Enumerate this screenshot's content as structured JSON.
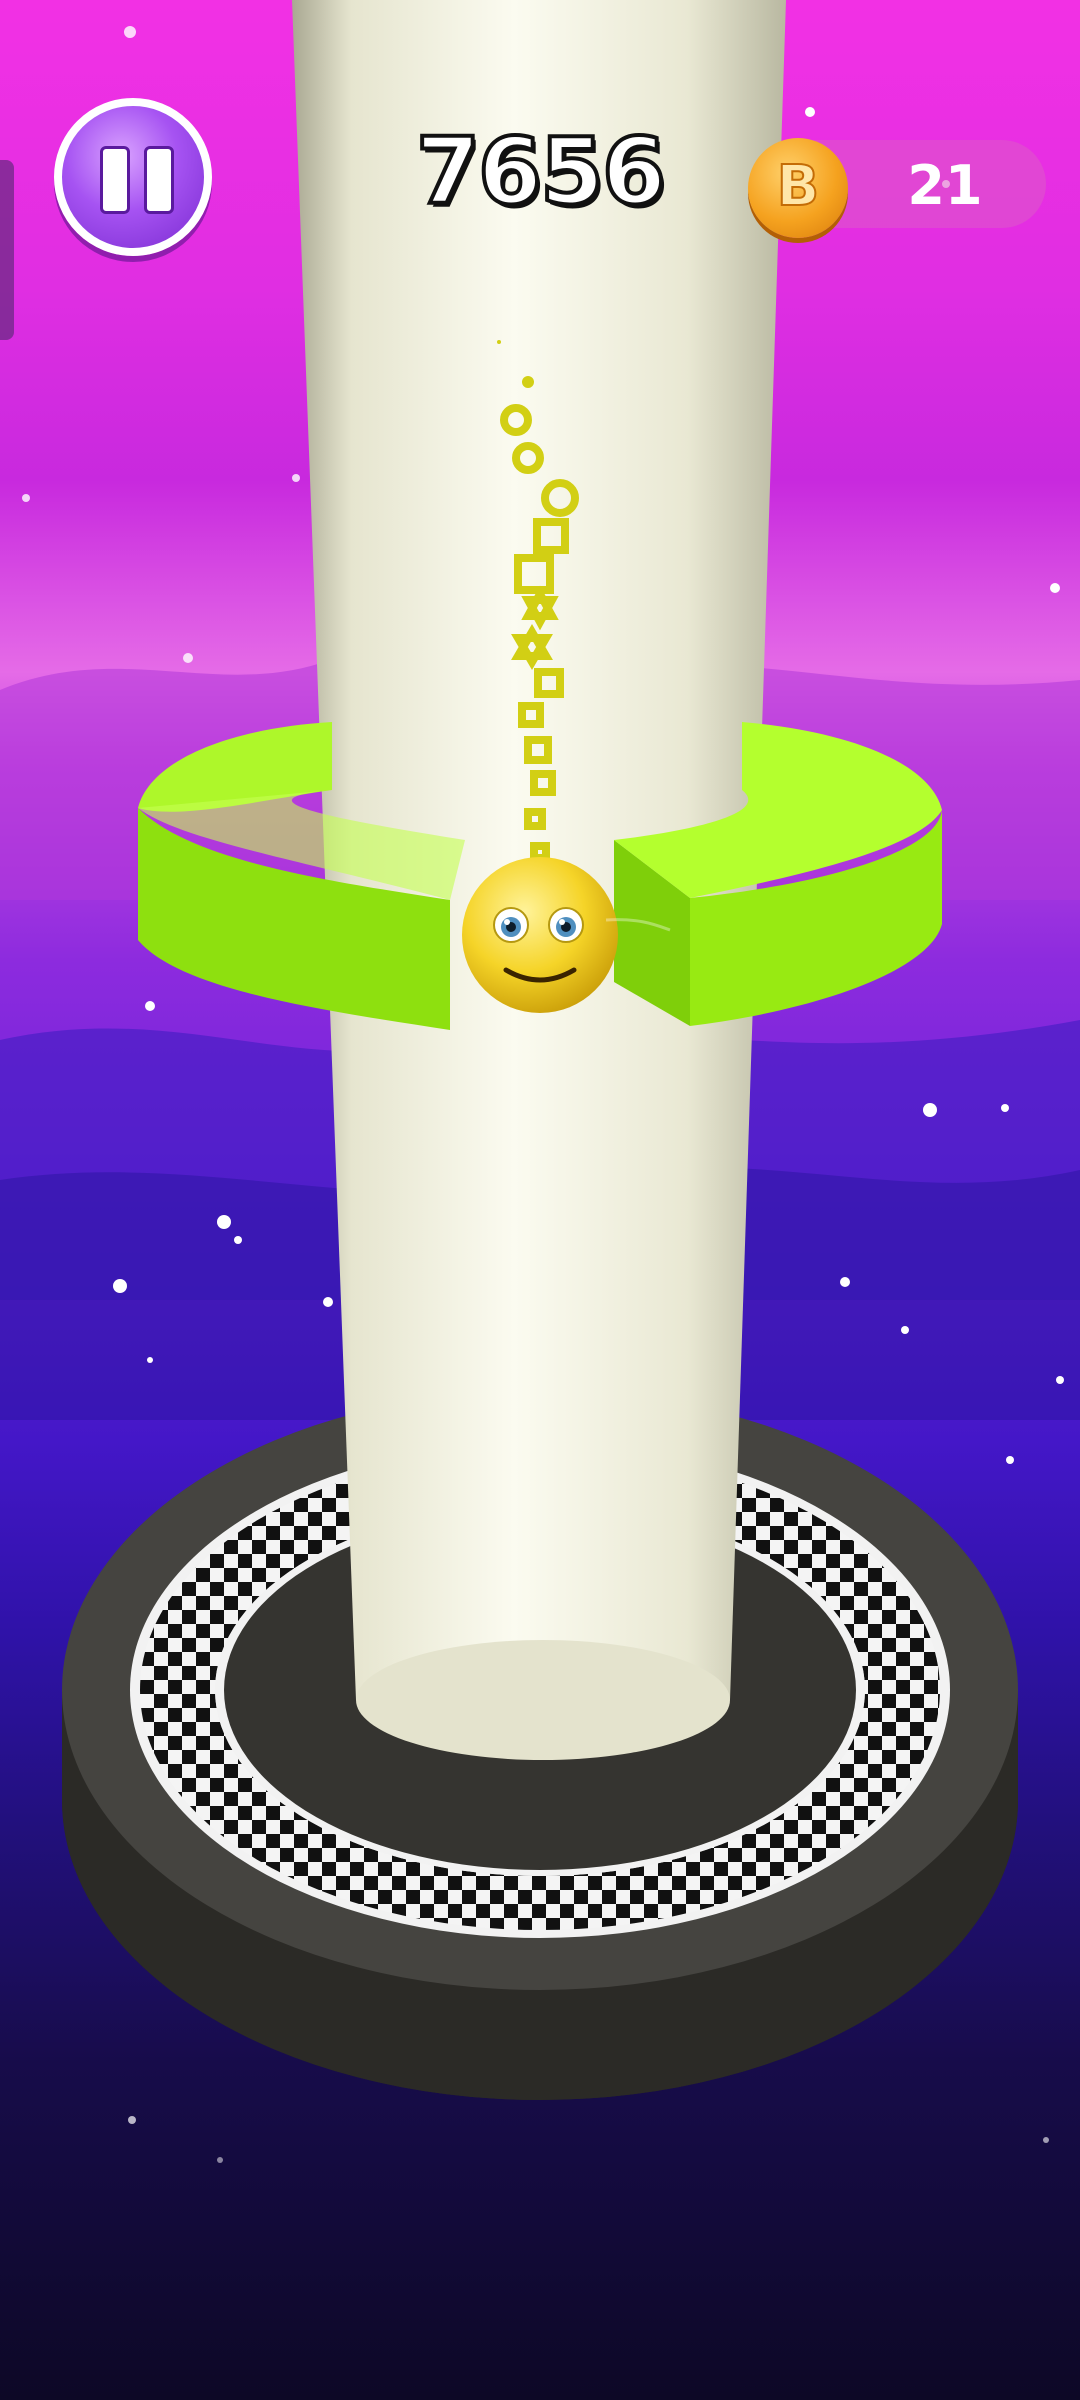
{
  "hud": {
    "score": "7656",
    "coin_letter": "B",
    "coin_count": "21"
  },
  "colors": {
    "platform_ring": "#a6f51e",
    "tower": "#f1f0dc",
    "ball": "#f7d526",
    "base": "#3a3934"
  },
  "icons": {
    "pause": "pause-icon",
    "coin": "coin-icon",
    "ball": "smiley-ball"
  }
}
